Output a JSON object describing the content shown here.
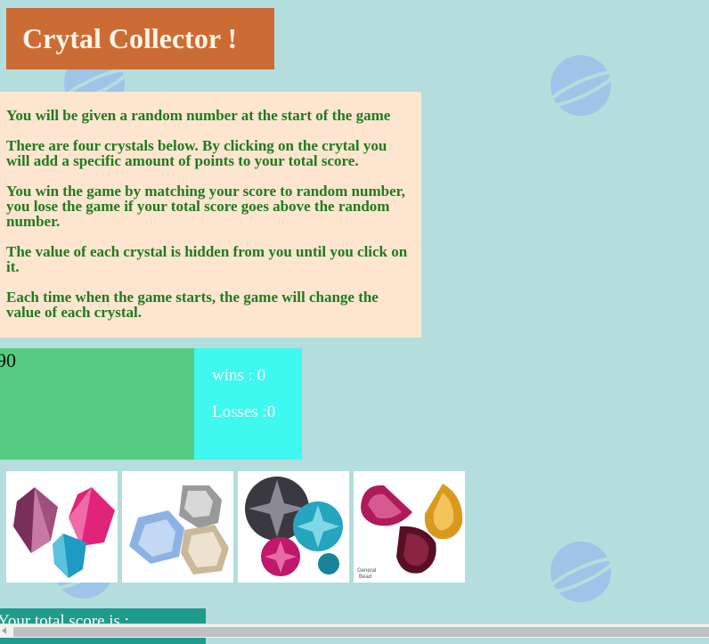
{
  "header": {
    "title": "Crytal Collector !"
  },
  "instructions": [
    "You will be given a random number at the start of the game",
    "There are four crystals below. By clicking on the crytal you will add a specific amount of points to your total score.",
    "You win the game by matching your score to random number, you lose the game if your total score goes above the random number.",
    "The value of each crystal is hidden from you until you click on it.",
    "Each time when the game starts, the game will change the value of each crystal."
  ],
  "target": {
    "value": "90"
  },
  "record": {
    "wins": "wins : 0",
    "losses": "Losses :0"
  },
  "score": {
    "label": "Your total score is :"
  },
  "crystals": [
    {
      "icon": "pink-bicone-crystals-icon"
    },
    {
      "icon": "blue-octagon-crystals-icon"
    },
    {
      "icon": "round-rivoli-crystals-icon"
    },
    {
      "icon": "pear-drop-crystals-icon",
      "caption": "General Bead"
    }
  ],
  "colors": {
    "background": "#b3dedd",
    "title_bg": "#cc6c35",
    "instructions_bg": "#fde5cf",
    "instructions_text": "#1e7b1e",
    "target_bg": "#55cb82",
    "record_bg": "#3ff8ef",
    "score_bg": "#1e9b8c"
  }
}
